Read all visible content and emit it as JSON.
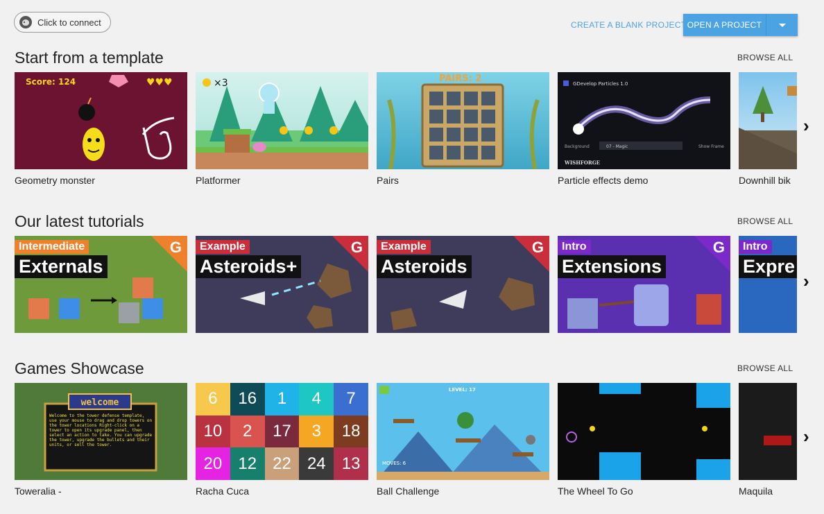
{
  "header": {
    "connect_label": "Click to connect",
    "create_blank_label": "CREATE A BLANK PROJECT",
    "open_project_label": "OPEN A PROJECT"
  },
  "sections": {
    "templates": {
      "title": "Start from a template",
      "browse_all": "BROWSE ALL",
      "items": [
        "Geometry monster",
        "Platformer",
        "Pairs",
        "Particle effects demo",
        "Downhill bik"
      ]
    },
    "tutorials": {
      "title": "Our latest tutorials",
      "browse_all": "BROWSE ALL",
      "items": [
        {
          "tag": "Intermediate",
          "title": "Externals"
        },
        {
          "tag": "Example",
          "title": "Asteroids+"
        },
        {
          "tag": "Example",
          "title": "Asteroids"
        },
        {
          "tag": "Intro",
          "title": "Extensions"
        },
        {
          "tag": "Intro",
          "title": "Expre"
        }
      ]
    },
    "showcase": {
      "title": "Games Showcase",
      "browse_all": "BROWSE ALL",
      "items": [
        "Toweralia -",
        "Racha Cuca",
        "Ball Challenge",
        "The Wheel To Go",
        "Maquila"
      ]
    }
  },
  "thumb_text": {
    "geo_score": "Score: 124",
    "plat_coins": "×3",
    "pairs_label": "PAIRS: 2",
    "particles_title": "GDevelop Particles 1.0",
    "particles_effect": "07 - Magic",
    "particles_background": "Background",
    "particles_show_frame": "Show Frame",
    "particles_brand": "WISHFORGE",
    "tower_title": "welcome",
    "tower_text": "Welcome to the tower defense template, use your mouse to drag and drop towers on the tower locations Right-click on a tower to open its upgrade panel, then select an action to take. You can upgrade the tower, upgrade the bullets and their units, or sell the tower.",
    "ball_level": "LEVEL: 17",
    "ball_moves": "MOVES: 6",
    "racha_numbers": [
      "6",
      "16",
      "1",
      "4",
      "7",
      "10",
      "2",
      "17",
      "3",
      "18",
      "20",
      "12",
      "22",
      "24",
      "13"
    ]
  },
  "colors": {
    "accent": "#4ba3e4",
    "racha": [
      "#f6c94c",
      "#0f4a57",
      "#1fb3e8",
      "#1ec7c3",
      "#3a6fd1",
      "#b8333f",
      "#d9534f",
      "#7b2a3d",
      "#f5a623",
      "#7d3b1f",
      "#e424e2",
      "#16806c",
      "#c9a07a",
      "#3a3a3a",
      "#b0304b"
    ]
  },
  "icons": {
    "next_arrow": "chevron-right",
    "dropdown": "caret-down",
    "avatar": "user-avatar"
  }
}
